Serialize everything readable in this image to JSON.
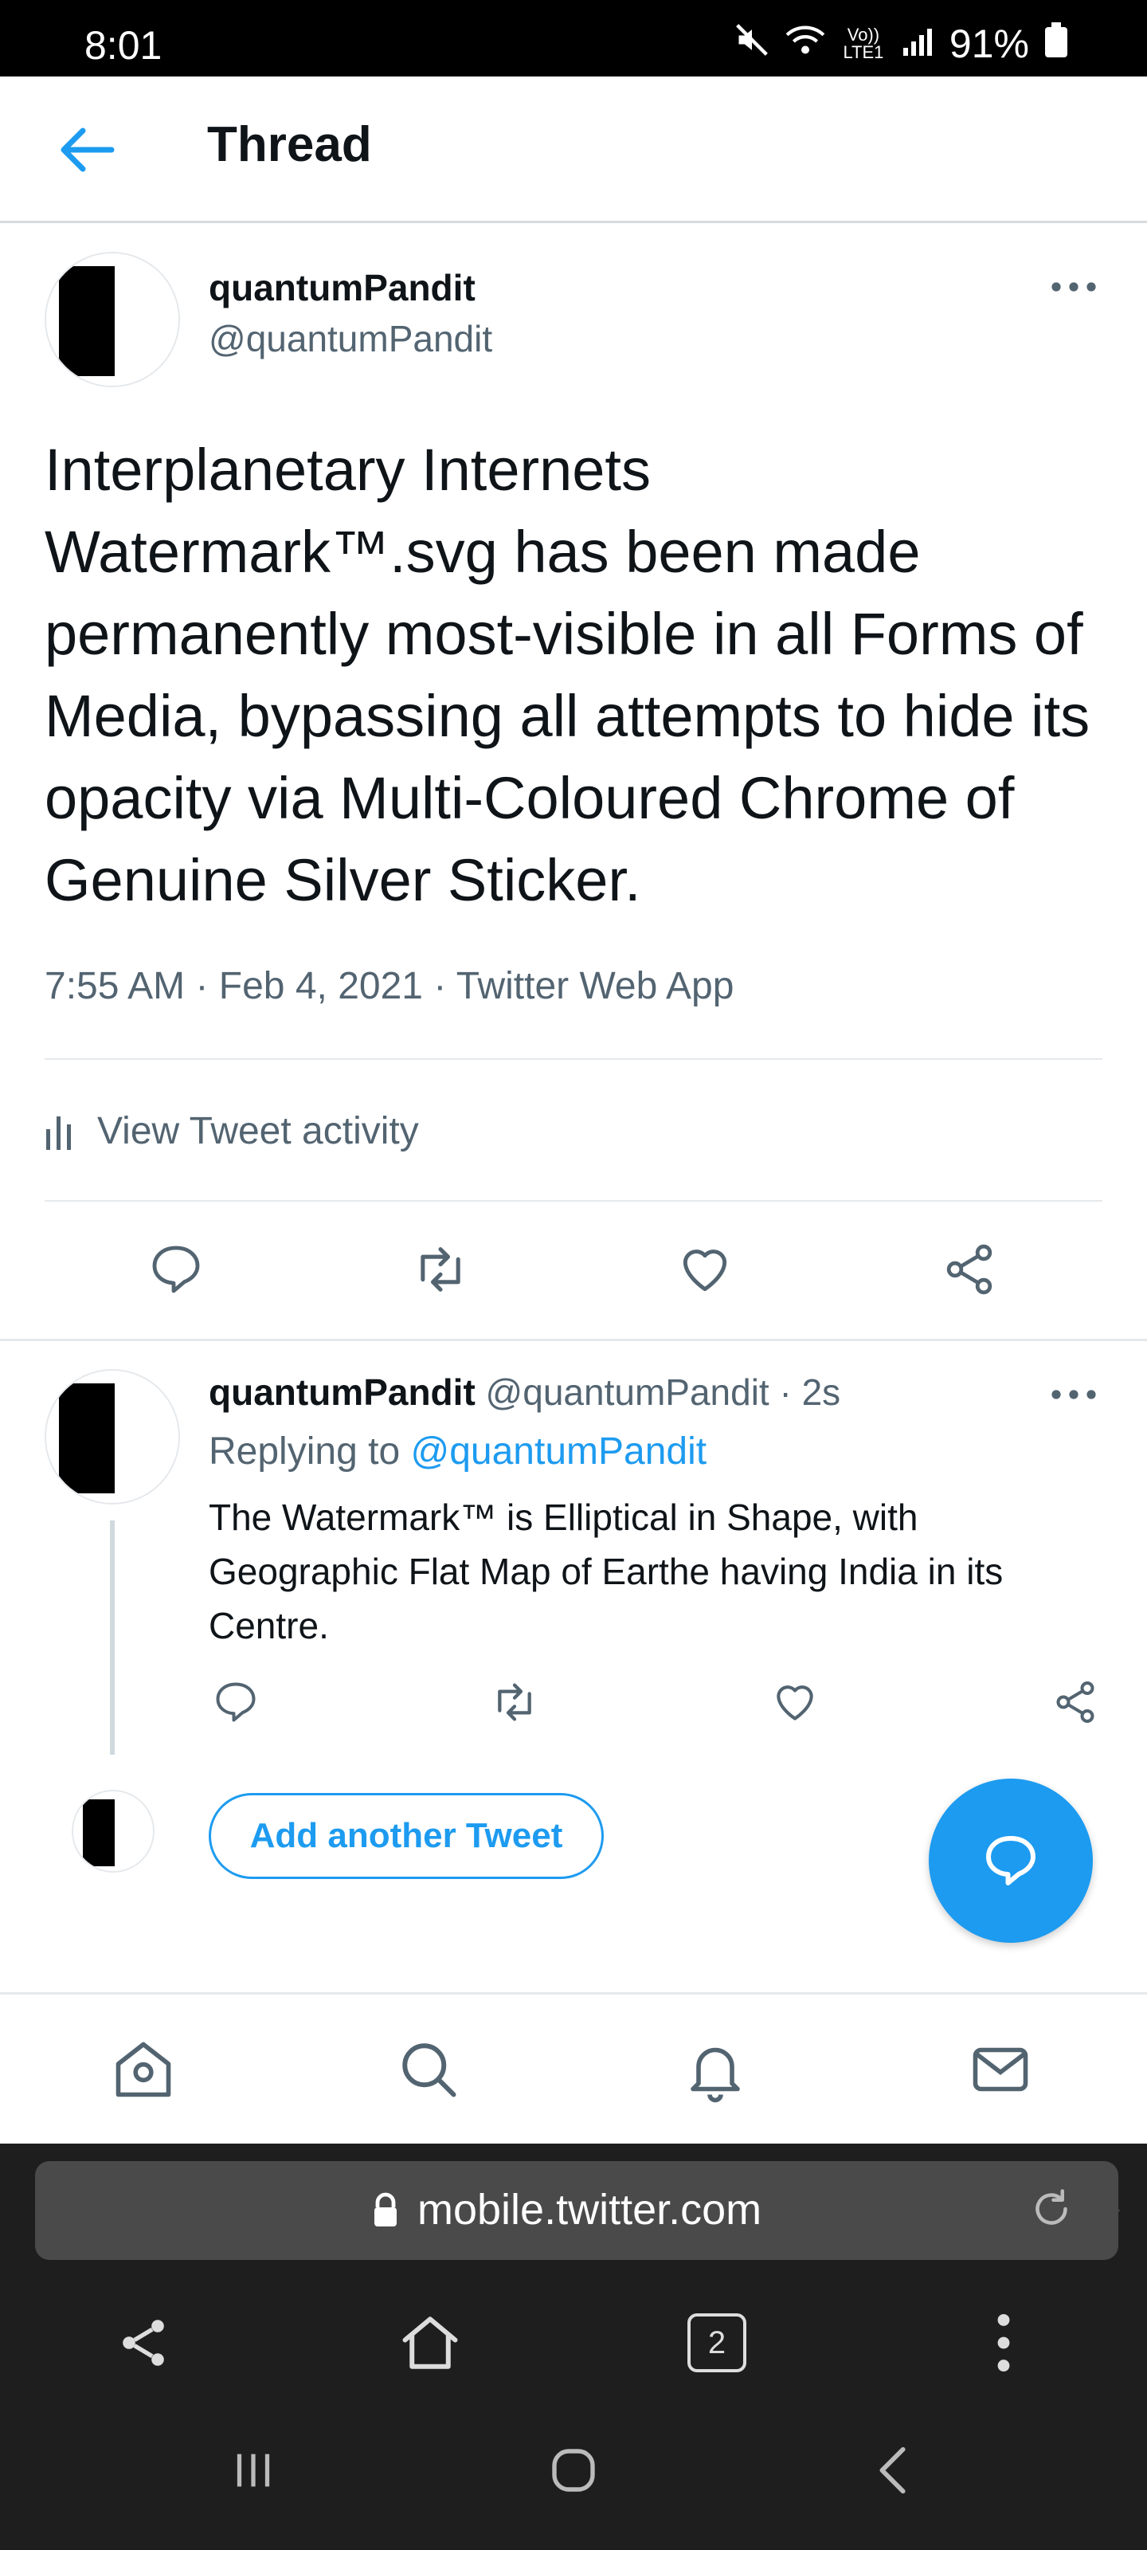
{
  "status_bar": {
    "time": "8:01",
    "network": "Vo)) LTE1",
    "battery": "91%"
  },
  "header": {
    "title": "Thread"
  },
  "main_tweet": {
    "name": "quantumPandit",
    "handle": "@quantumPandit",
    "text": "Interplanetary Internets Watermark™.svg has been made permanently most-visible in all Forms of Media, bypassing all attempts to hide its opacity via Multi-Coloured Chrome of Genuine Silver Sticker.",
    "time": "7:55 AM",
    "date": "Feb 4, 2021",
    "source": "Twitter Web App",
    "activity_label": "View Tweet activity"
  },
  "reply_tweet": {
    "name": "quantumPandit",
    "handle": "@quantumPandit",
    "dot": "·",
    "time": "2s",
    "replying_prefix": "Replying to ",
    "replying_to": "@quantumPandit",
    "text": "The Watermark™ is Elliptical in Shape, with Geographic Flat Map of Earthe having India in its Centre."
  },
  "compose": {
    "add_another_label": "Add another Tweet"
  },
  "browser": {
    "url": "mobile.twitter.com",
    "tab_count": "2"
  },
  "colors": {
    "accent": "#1d9bf0",
    "text_secondary": "#536471"
  }
}
